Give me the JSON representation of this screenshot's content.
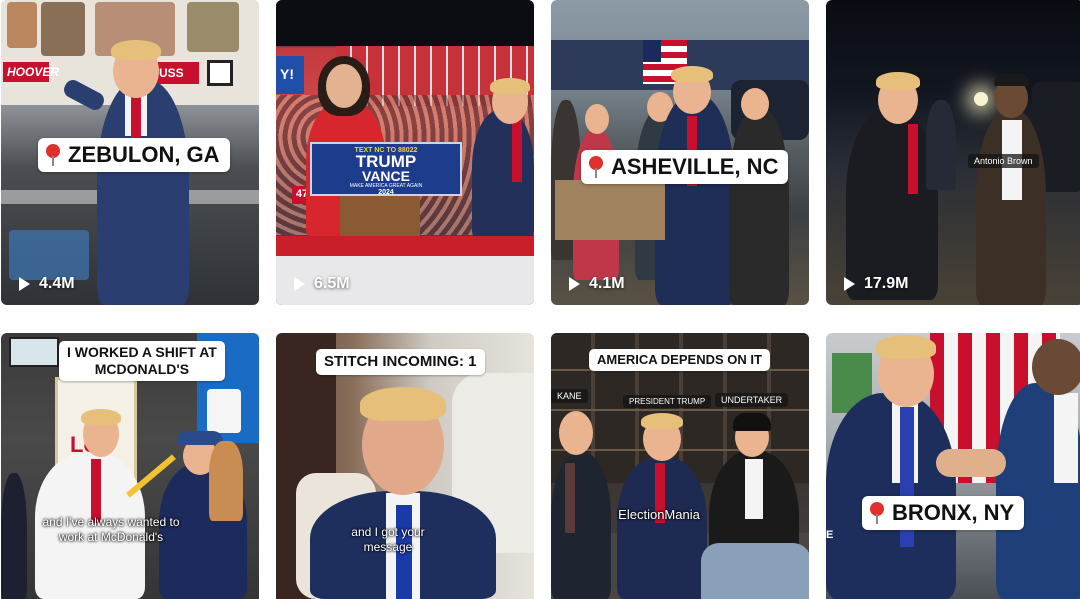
{
  "tiles": [
    {
      "id": 1,
      "views": "4.4M",
      "location": "ZEBULON, GA",
      "truck_left": "HOOVER",
      "truck_right": "USS"
    },
    {
      "id": 2,
      "views": "6.5M",
      "podium_top": "TEXT NC TO 88022",
      "podium_main_1": "TRUMP",
      "podium_main_2": "VANCE",
      "podium_sub": "MAKE AMERICA GREAT AGAIN",
      "podium_year": "2024",
      "sign_text": "47"
    },
    {
      "id": 3,
      "views": "4.1M",
      "location": "ASHEVILLE, NC"
    },
    {
      "id": 4,
      "views": "17.9M",
      "name_tag": "Antonio Brown"
    },
    {
      "id": 5,
      "caption_line1": "I WORKED A SHIFT AT",
      "caption_line2": "MCDONALD'S",
      "subtitle_line1": "and I've always wanted to",
      "subtitle_line2": "work at McDonald's",
      "sign": "Lo"
    },
    {
      "id": 6,
      "caption": "STITCH INCOMING: 1",
      "subtitle_line1": "and I got your",
      "subtitle_line2": "message"
    },
    {
      "id": 7,
      "caption": "AMERICA DEPENDS ON IT",
      "tag_left": "KANE",
      "tag_mid": "PRESIDENT TRUMP",
      "tag_right": "UNDERTAKER",
      "watermark": "ElectionMania"
    },
    {
      "id": 8,
      "location": "BRONX, NY",
      "edge_letter": "E"
    }
  ],
  "colors": {
    "pin": "#e0302c",
    "tie": "#c8102e",
    "suit": "#1f2f5c"
  }
}
